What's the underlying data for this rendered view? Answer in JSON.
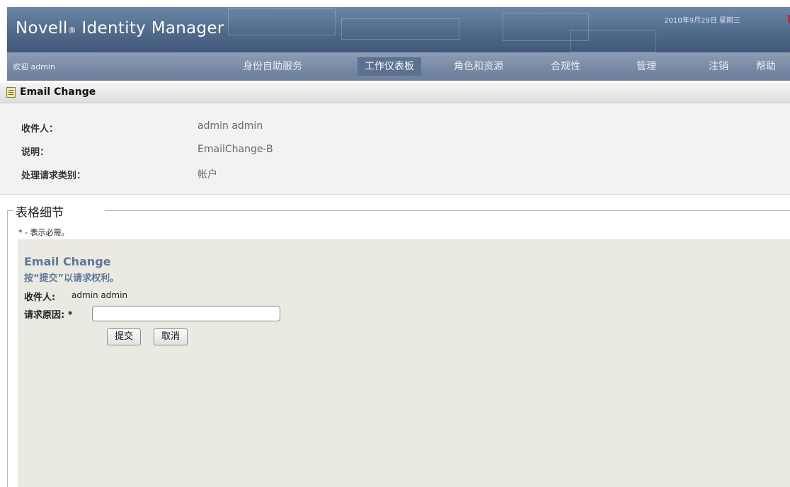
{
  "header": {
    "logo_text": "Novell",
    "logo_reg": "®",
    "logo_product": " Identity Manager",
    "date": "2010年9月29日 星期三"
  },
  "nav": {
    "welcome": "欢迎 admin",
    "tabs": [
      {
        "label": "身份自助服务",
        "active": false
      },
      {
        "label": "工作仪表板",
        "active": true
      },
      {
        "label": "角色和资源",
        "active": false
      },
      {
        "label": "合规性",
        "active": false
      },
      {
        "label": "管理",
        "active": false
      },
      {
        "label": "注销",
        "active": false
      },
      {
        "label": "帮助",
        "active": false
      }
    ]
  },
  "page": {
    "title": "Email Change",
    "icon": "document-icon"
  },
  "info": {
    "rows": [
      {
        "label": "收件人：",
        "value": "admin admin"
      },
      {
        "label": "说明：",
        "value": "EmailChange-B"
      },
      {
        "label": "处理请求类别：",
        "value": "帐户"
      }
    ]
  },
  "form": {
    "legend": "表格细节",
    "required_note": "* - 表示必需。",
    "title": "Email Change",
    "subtitle": "按“提交”以请求权利。",
    "recipient_label": "收件人:",
    "recipient_value": "admin admin",
    "reason_label": "请求原因:",
    "reason_required": "*",
    "reason_value": "",
    "submit_label": "提交",
    "cancel_label": "取消"
  },
  "colors": {
    "banner": "#556f91",
    "nav_active": "#5b7192",
    "form_heading": "#5e7898",
    "form_bg": "#eaeae3"
  }
}
